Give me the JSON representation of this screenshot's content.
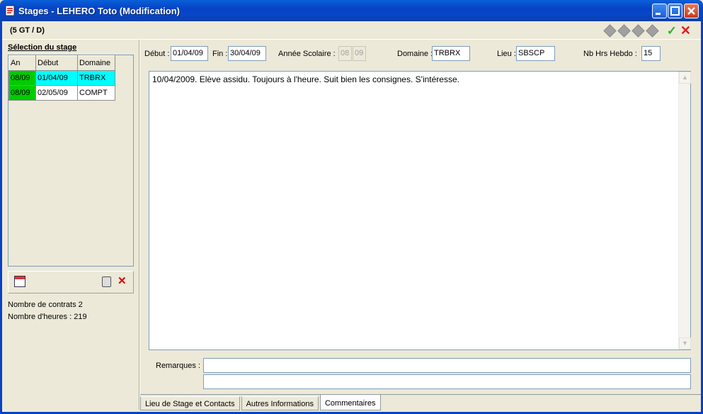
{
  "window": {
    "title": "Stages - LEHERO Toto (Modification)"
  },
  "header": {
    "class_label": "(5 GT / D)"
  },
  "left": {
    "title": "Sélection du stage",
    "columns": [
      "An",
      "Début",
      "Domaine"
    ],
    "rows": [
      {
        "an": "08/09",
        "debut": "01/04/09",
        "domaine": "TRBRX"
      },
      {
        "an": "08/09",
        "debut": "02/05/09",
        "domaine": "COMPT"
      }
    ],
    "stats": {
      "contracts_label": "Nombre de contrats",
      "contracts_value": "2",
      "hours_label": "Nombre d'heures :",
      "hours_value": "219"
    }
  },
  "fields": {
    "debut_label": "Début :",
    "debut_value": "01/04/09",
    "fin_label": "Fin :",
    "fin_value": "30/04/09",
    "annee_label": "Année Scolaire :",
    "annee_from": "08",
    "annee_to": "09",
    "domaine_label": "Domaine :",
    "domaine_value": "TRBRX",
    "lieu_label": "Lieu :",
    "lieu_value": "SBSCP",
    "hebdo_label": "Nb Hrs Hebdo :",
    "hebdo_value": "15"
  },
  "comment": {
    "text": "10/04/2009. Elève assidu. Toujours à l'heure. Suit bien les consignes. S'intéresse."
  },
  "remarks": {
    "label": "Remarques :",
    "line1": "",
    "line2": ""
  },
  "tabs": [
    {
      "label": "Lieu de Stage et Contacts"
    },
    {
      "label": "Autres Informations"
    },
    {
      "label": "Commentaires",
      "active": true
    }
  ],
  "colors": {
    "title_bar": "#0543c6",
    "row_green": "#00cc00",
    "row_selected": "#00ffff",
    "validate": "#2bb22b",
    "cancel": "#e21a1a"
  }
}
